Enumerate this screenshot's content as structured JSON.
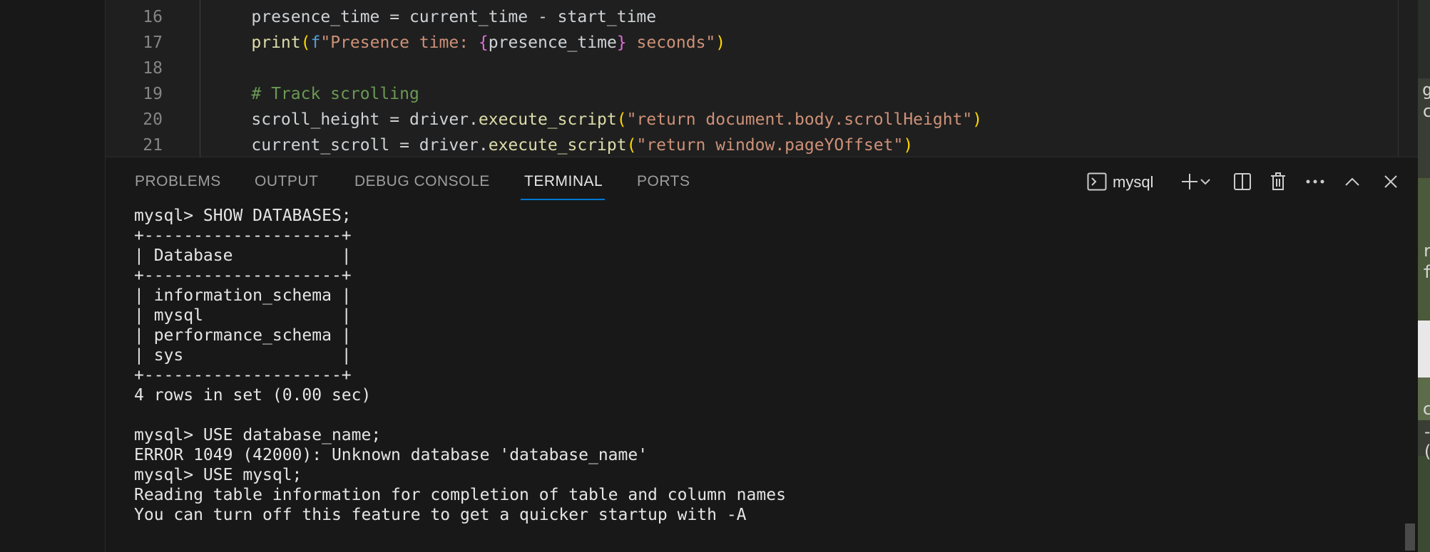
{
  "editor": {
    "lines": [
      {
        "num": "16",
        "tokens": [
          {
            "t": "    presence_time = current_time - start_time",
            "c": "tok-var"
          }
        ]
      },
      {
        "num": "17",
        "tokens": [
          {
            "t": "    ",
            "c": "tok-var"
          },
          {
            "t": "print",
            "c": "tok-fn"
          },
          {
            "t": "(",
            "c": "tok-par"
          },
          {
            "t": "f",
            "c": "tok-kw"
          },
          {
            "t": "\"Presence time: ",
            "c": "tok-str"
          },
          {
            "t": "{",
            "c": "tok-brace"
          },
          {
            "t": "presence_time",
            "c": "tok-var"
          },
          {
            "t": "}",
            "c": "tok-brace"
          },
          {
            "t": " seconds\"",
            "c": "tok-str"
          },
          {
            "t": ")",
            "c": "tok-par"
          }
        ]
      },
      {
        "num": "18",
        "tokens": []
      },
      {
        "num": "19",
        "tokens": [
          {
            "t": "    # Track scrolling",
            "c": "tok-com"
          }
        ]
      },
      {
        "num": "20",
        "tokens": [
          {
            "t": "    scroll_height = driver.",
            "c": "tok-var"
          },
          {
            "t": "execute_script",
            "c": "tok-fn"
          },
          {
            "t": "(",
            "c": "tok-par"
          },
          {
            "t": "\"return document.body.scrollHeight\"",
            "c": "tok-str"
          },
          {
            "t": ")",
            "c": "tok-par"
          }
        ]
      },
      {
        "num": "21",
        "tokens": [
          {
            "t": "    current_scroll = driver.",
            "c": "tok-var"
          },
          {
            "t": "execute_script",
            "c": "tok-fn"
          },
          {
            "t": "(",
            "c": "tok-par"
          },
          {
            "t": "\"return window.pageYOffset\"",
            "c": "tok-str"
          },
          {
            "t": ")",
            "c": "tok-par"
          }
        ]
      }
    ]
  },
  "panel": {
    "tabs": [
      {
        "label": "PROBLEMS",
        "active": false
      },
      {
        "label": "OUTPUT",
        "active": false
      },
      {
        "label": "DEBUG CONSOLE",
        "active": false
      },
      {
        "label": "TERMINAL",
        "active": true
      },
      {
        "label": "PORTS",
        "active": false
      }
    ],
    "terminal_name": "mysql",
    "icons": [
      "terminal-icon",
      "new-terminal-icon",
      "chevron-down-icon",
      "split-terminal-icon",
      "trash-icon",
      "more-actions-icon",
      "maximize-panel-icon",
      "close-panel-icon"
    ]
  },
  "terminal": {
    "lines": [
      "mysql> SHOW DATABASES;",
      "+--------------------+",
      "| Database           |",
      "+--------------------+",
      "| information_schema |",
      "| mysql              |",
      "| performance_schema |",
      "| sys                |",
      "+--------------------+",
      "4 rows in set (0.00 sec)",
      "",
      "mysql> USE database_name;",
      "ERROR 1049 (42000): Unknown database 'database_name'",
      "mysql> USE mysql;",
      "Reading table information for completion of table and column names",
      "You can turn off this feature to get a quicker startup with -A"
    ]
  },
  "background_fragments": [
    "g",
    "ct",
    "rc",
    "f",
    "cr",
    "-("
  ]
}
